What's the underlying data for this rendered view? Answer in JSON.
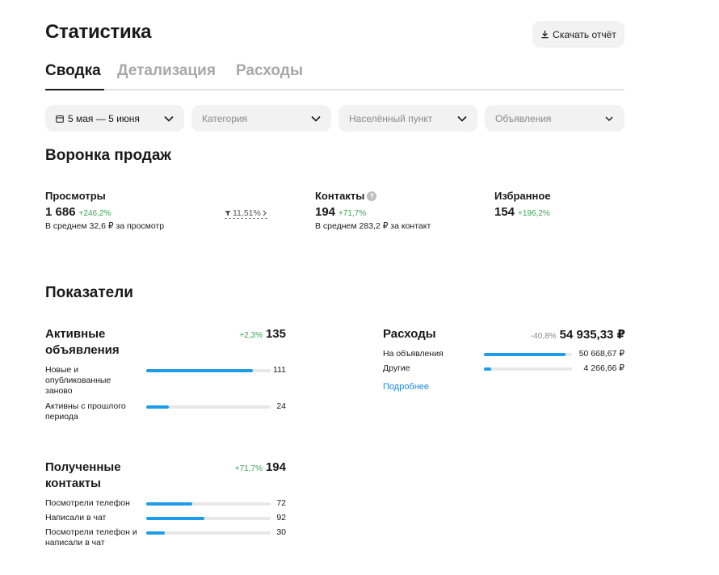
{
  "header": {
    "title": "Статистика",
    "download_label": "Скачать отчёт"
  },
  "tabs": [
    {
      "label": "Сводка",
      "active": true
    },
    {
      "label": "Детализация",
      "active": false
    },
    {
      "label": "Расходы",
      "active": false
    }
  ],
  "filters": {
    "period": "5 мая — 5 июня",
    "category": "Категория",
    "city": "Населённый пункт",
    "ads": "Объявления"
  },
  "funnel": {
    "title": "Воронка продаж",
    "views": {
      "label": "Просмотры",
      "value": "1 686",
      "delta": "+246,2%",
      "note": "В среднем 32,6 ₽ за просмотр"
    },
    "conversion": "11,51%",
    "contacts": {
      "label": "Контакты",
      "value": "194",
      "delta": "+71,7%",
      "note": "В среднем 283,2 ₽ за контакт"
    },
    "favorites": {
      "label": "Избранное",
      "value": "154",
      "delta": "+196,2%"
    }
  },
  "indicators": {
    "title": "Показатели",
    "active_ads": {
      "title": "Активные объявления",
      "delta": "+2,3%",
      "total": "135",
      "rows": [
        {
          "label": "Новые и опубликованные заново",
          "value": "111",
          "fraction": 0.86
        },
        {
          "label": "Активны с прошлого периода",
          "value": "24",
          "fraction": 0.18
        }
      ]
    },
    "expenses": {
      "title": "Расходы",
      "delta": "-40,8%",
      "total": "54 935,33 ₽",
      "rows": [
        {
          "label": "На объявления",
          "value": "50 668,67 ₽",
          "fraction": 0.93
        },
        {
          "label": "Другие",
          "value": "4 266,66 ₽",
          "fraction": 0.08
        }
      ],
      "more_label": "Подробнее"
    },
    "contacts": {
      "title": "Полученные контакты",
      "delta": "+71,7%",
      "total": "194",
      "rows": [
        {
          "label": "Посмотрели телефон",
          "value": "72",
          "fraction": 0.37
        },
        {
          "label": "Написали в чат",
          "value": "92",
          "fraction": 0.47
        },
        {
          "label": "Посмотрели телефон и написали в чат",
          "value": "30",
          "fraction": 0.15
        }
      ]
    }
  },
  "colors": {
    "accent": "#1e9be9",
    "positive": "#3aa655",
    "link": "#1e88e5"
  }
}
